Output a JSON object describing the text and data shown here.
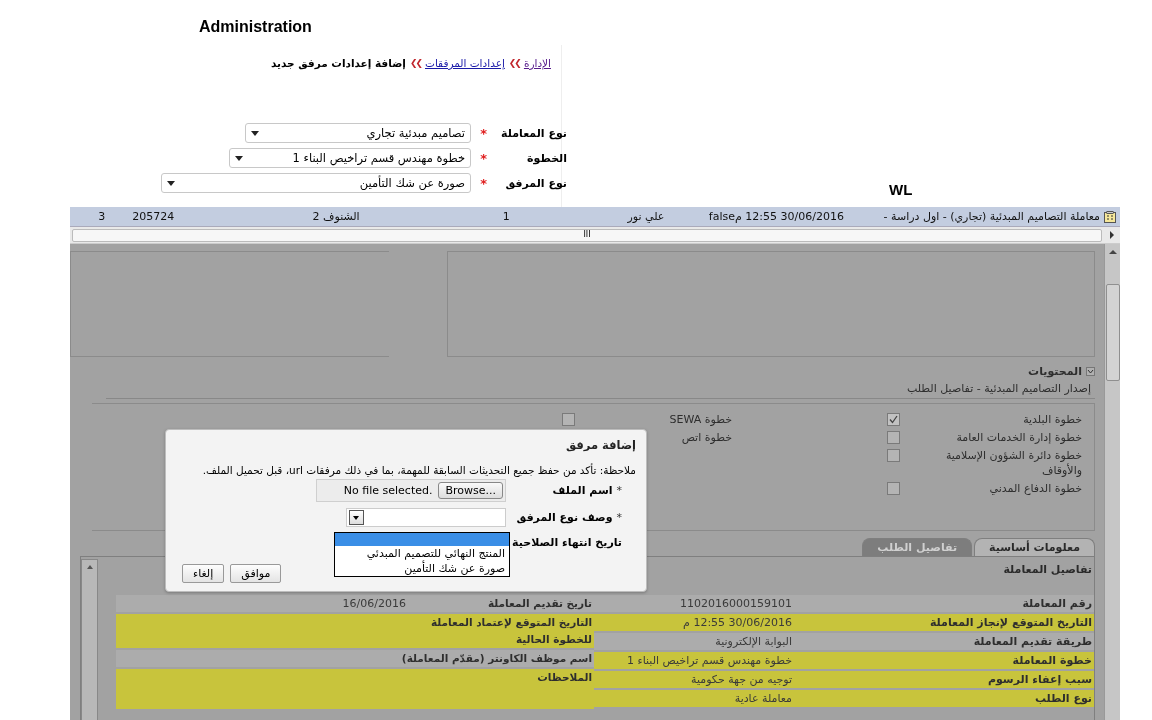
{
  "page_title": "Administration",
  "admin": {
    "breadcrumb": [
      {
        "text": "الإدارة",
        "kind": "link"
      },
      {
        "text": "إعدادات المرفقات",
        "kind": "link"
      },
      {
        "text": "إضافة إعدادات مرفق جديد",
        "kind": "current"
      }
    ],
    "separator": "❯❯",
    "fields": [
      {
        "label": "نوع المعاملة",
        "marker": "*",
        "value": "تصاميم مبدئية تجاري"
      },
      {
        "label": "الخطوة",
        "marker": "*",
        "value": "خطوة مهندس قسم تراخيص البناء 1"
      },
      {
        "label": "نوع المرفق",
        "marker": "*",
        "value": "صورة عن شك التأمين"
      }
    ]
  },
  "section_label": "WL",
  "task_row": {
    "cells": [
      "معاملة التصاميم المبدئية (تجاري) - اول دراسة -",
      "30/06/2016 12:55 م",
      "false",
      "علي نور",
      "1",
      "الشنوف 2",
      "205724",
      "3"
    ]
  },
  "scroll_grip": "III",
  "contents": {
    "heading": "المحتويات",
    "expanded": true,
    "subtitle": "إصدار التصاميم المبدئية - تفاصيل الطلب",
    "steps": [
      {
        "label": "خطوة البلدية",
        "checked": true
      },
      {
        "label": "خطوة إدارة الخدمات العامة",
        "checked": false
      },
      {
        "label": "خطوة دائرة الشؤون الإسلامية والأوقاف",
        "checked": false
      },
      {
        "label": "خطوة الدفاع المدني",
        "checked": false
      }
    ],
    "steps_2": [
      {
        "label": "خطوة SEWA",
        "checked": false
      },
      {
        "label": "خطوة اتص"
      }
    ]
  },
  "tabs": [
    {
      "label": "معلومات أساسية",
      "selected": true
    },
    {
      "label": "تفاصيل الطلب",
      "selected": false
    }
  ],
  "details": {
    "title": "تفاصيل المعاملة",
    "right": [
      {
        "label": "رقم المعاملة",
        "value": "1102016000159101",
        "highlighted": false
      },
      {
        "label": "التاريخ المتوقع لإنجاز المعاملة",
        "value": "30/06/2016 12:55 م",
        "highlighted": true
      },
      {
        "label": "طريقة تقديم المعاملة",
        "value": "البوابة الإلكترونية",
        "highlighted": false
      },
      {
        "label": "خطوة المعاملة",
        "value": "خطوة مهندس قسم تراخيص البناء 1",
        "highlighted": true
      },
      {
        "label": "سبب إعفاء الرسوم",
        "value": "توجيه من جهة حكومية",
        "highlighted": true
      },
      {
        "label": "نوع الطلب",
        "value": "معاملة عادية",
        "highlighted": true
      }
    ],
    "left": [
      {
        "label": "تاريخ تقديم المعاملة",
        "value": "16/06/2016",
        "highlighted": false
      },
      {
        "label": "التاريخ المتوقع لإعتماد المعاملة للخطوة الحالية",
        "highlighted": true
      },
      {
        "label": "اسم موظف الكاونتر (مقدّم المعاملة)",
        "highlighted": false
      },
      {
        "label": "الملاحظات",
        "highlighted": true
      }
    ]
  },
  "dialog": {
    "title": "إضافة مرفق",
    "note": "ملاحظة: تأكد من حفظ جميع التحديثات السابقة للمهمة، بما في ذلك مرفقات url، قبل تحميل الملف.",
    "file_label": "اسم الملف",
    "file_marker": "*",
    "browse": "Browse...",
    "file_status": "No file selected.",
    "type_label": "وصف نوع المرفق",
    "type_marker": "*",
    "expiry_label": "تاريخ انتهاء الصلاحية",
    "options": [
      "المنتج النهائي للتصميم المبدئي",
      "صورة عن شك التأمين"
    ],
    "buttons": [
      "موافق",
      "إلغاء"
    ]
  }
}
